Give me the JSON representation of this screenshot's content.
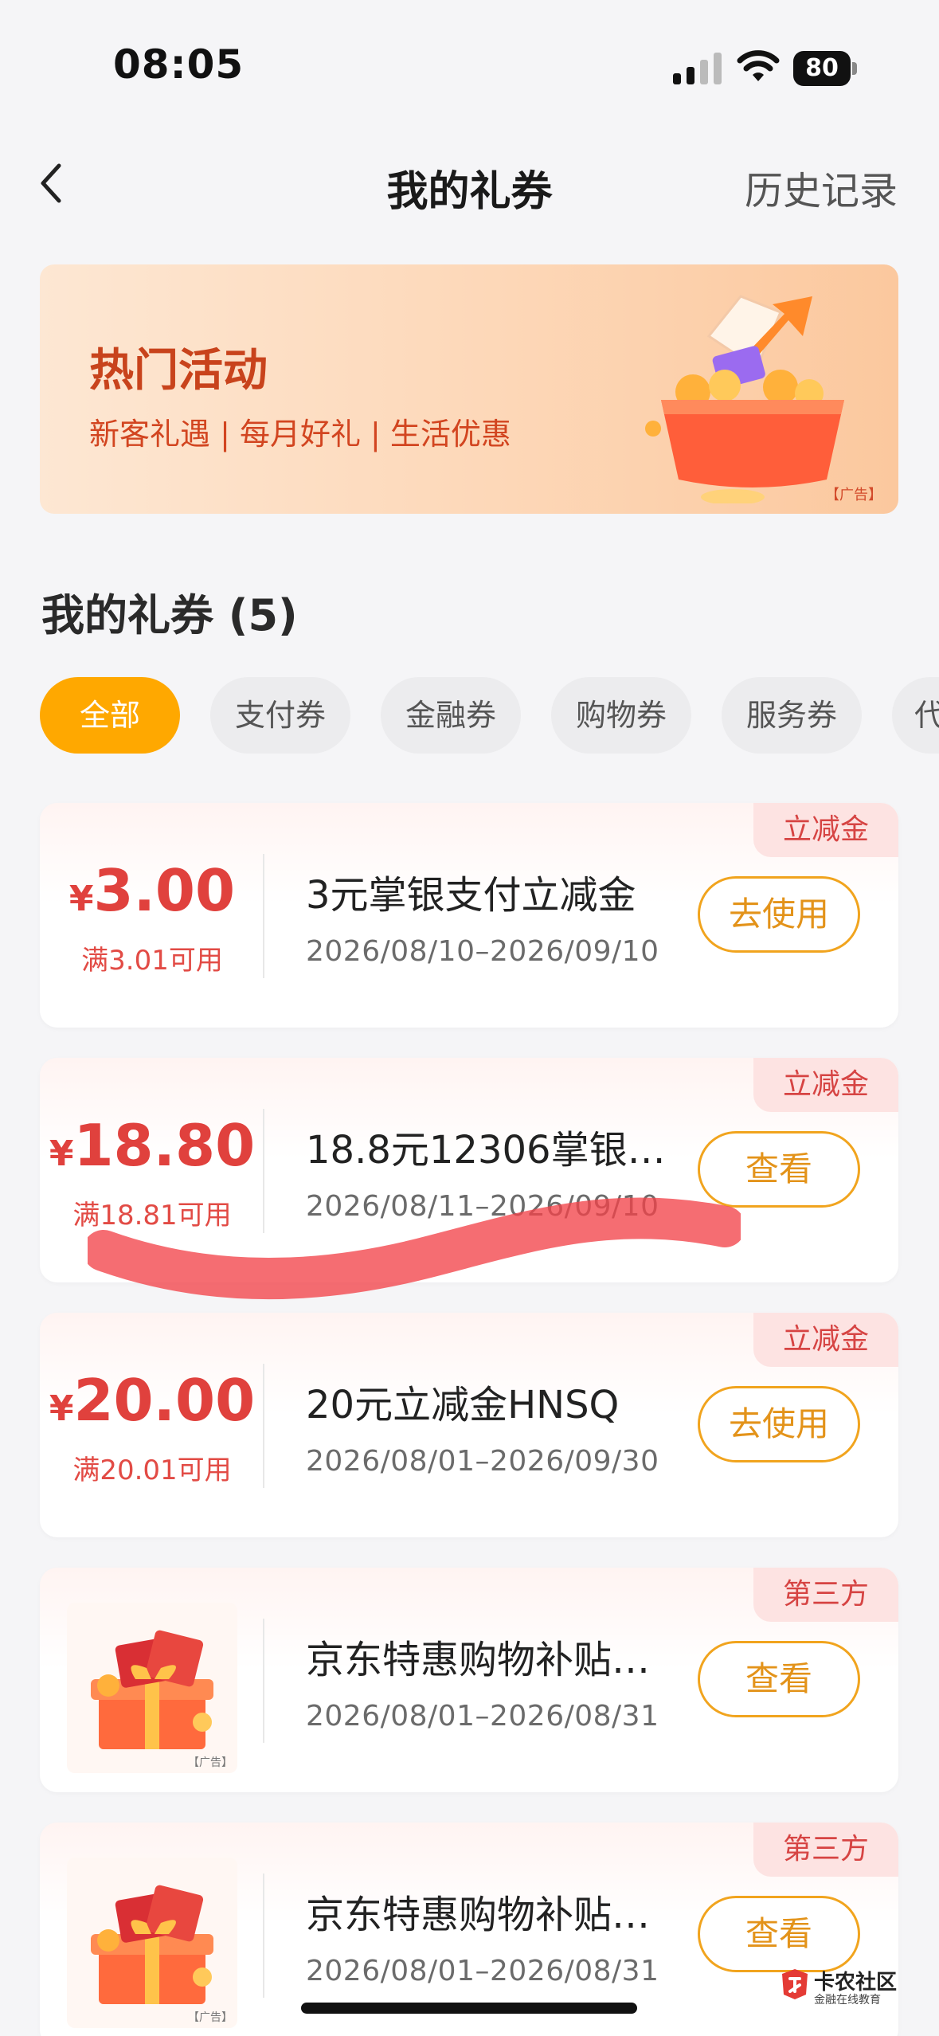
{
  "status_bar": {
    "time": "08:05",
    "battery": "80"
  },
  "nav": {
    "title": "我的礼券",
    "history": "历史记录"
  },
  "banner": {
    "title": "热门活动",
    "subtitle": "新客礼遇 | 每月好礼 | 生活优惠",
    "ad_label": "【广告】"
  },
  "section": {
    "title": "我的礼券 (5)"
  },
  "tabs": [
    {
      "label": "全部",
      "active": true
    },
    {
      "label": "支付券",
      "active": false
    },
    {
      "label": "金融券",
      "active": false
    },
    {
      "label": "购物券",
      "active": false
    },
    {
      "label": "服务券",
      "active": false
    },
    {
      "label": "代",
      "active": false
    }
  ],
  "coupons": [
    {
      "tag": "立减金",
      "currency": "¥",
      "amount": "3.00",
      "condition": "满3.01可用",
      "title": "3元掌银支付立减金",
      "date": "2026/08/10–2026/09/10",
      "button": "去使用"
    },
    {
      "tag": "立减金",
      "currency": "¥",
      "amount": "18.80",
      "condition": "满18.81可用",
      "title": "18.8元12306掌银…",
      "date": "2026/08/11–2026/09/10",
      "button": "查看"
    },
    {
      "tag": "立减金",
      "currency": "¥",
      "amount": "20.00",
      "condition": "满20.01可用",
      "title": "20元立减金HNSQ",
      "date": "2026/08/01–2026/09/30",
      "button": "去使用"
    },
    {
      "tag": "第三方",
      "thumb_ad": "【广告】",
      "title": "京东特惠购物补贴…",
      "date": "2026/08/01–2026/08/31",
      "button": "查看"
    },
    {
      "tag": "第三方",
      "thumb_ad": "【广告】",
      "title": "京东特惠购物补贴…",
      "date": "2026/08/01–2026/08/31",
      "button": "查看"
    }
  ],
  "watermark": {
    "name": "卡农社区",
    "sub": "金融在线教育"
  },
  "colors": {
    "accent": "#ffa800",
    "price_red": "#e0413d",
    "button_orange": "#f1a41e",
    "tag_bg": "#fde3e2",
    "scribble": "#f2444a"
  },
  "icons": {
    "back": "chevron-left-icon",
    "signal": "cellular-signal-icon",
    "wifi": "wifi-icon",
    "battery": "battery-icon",
    "gift_box": "gift-box-icon"
  }
}
